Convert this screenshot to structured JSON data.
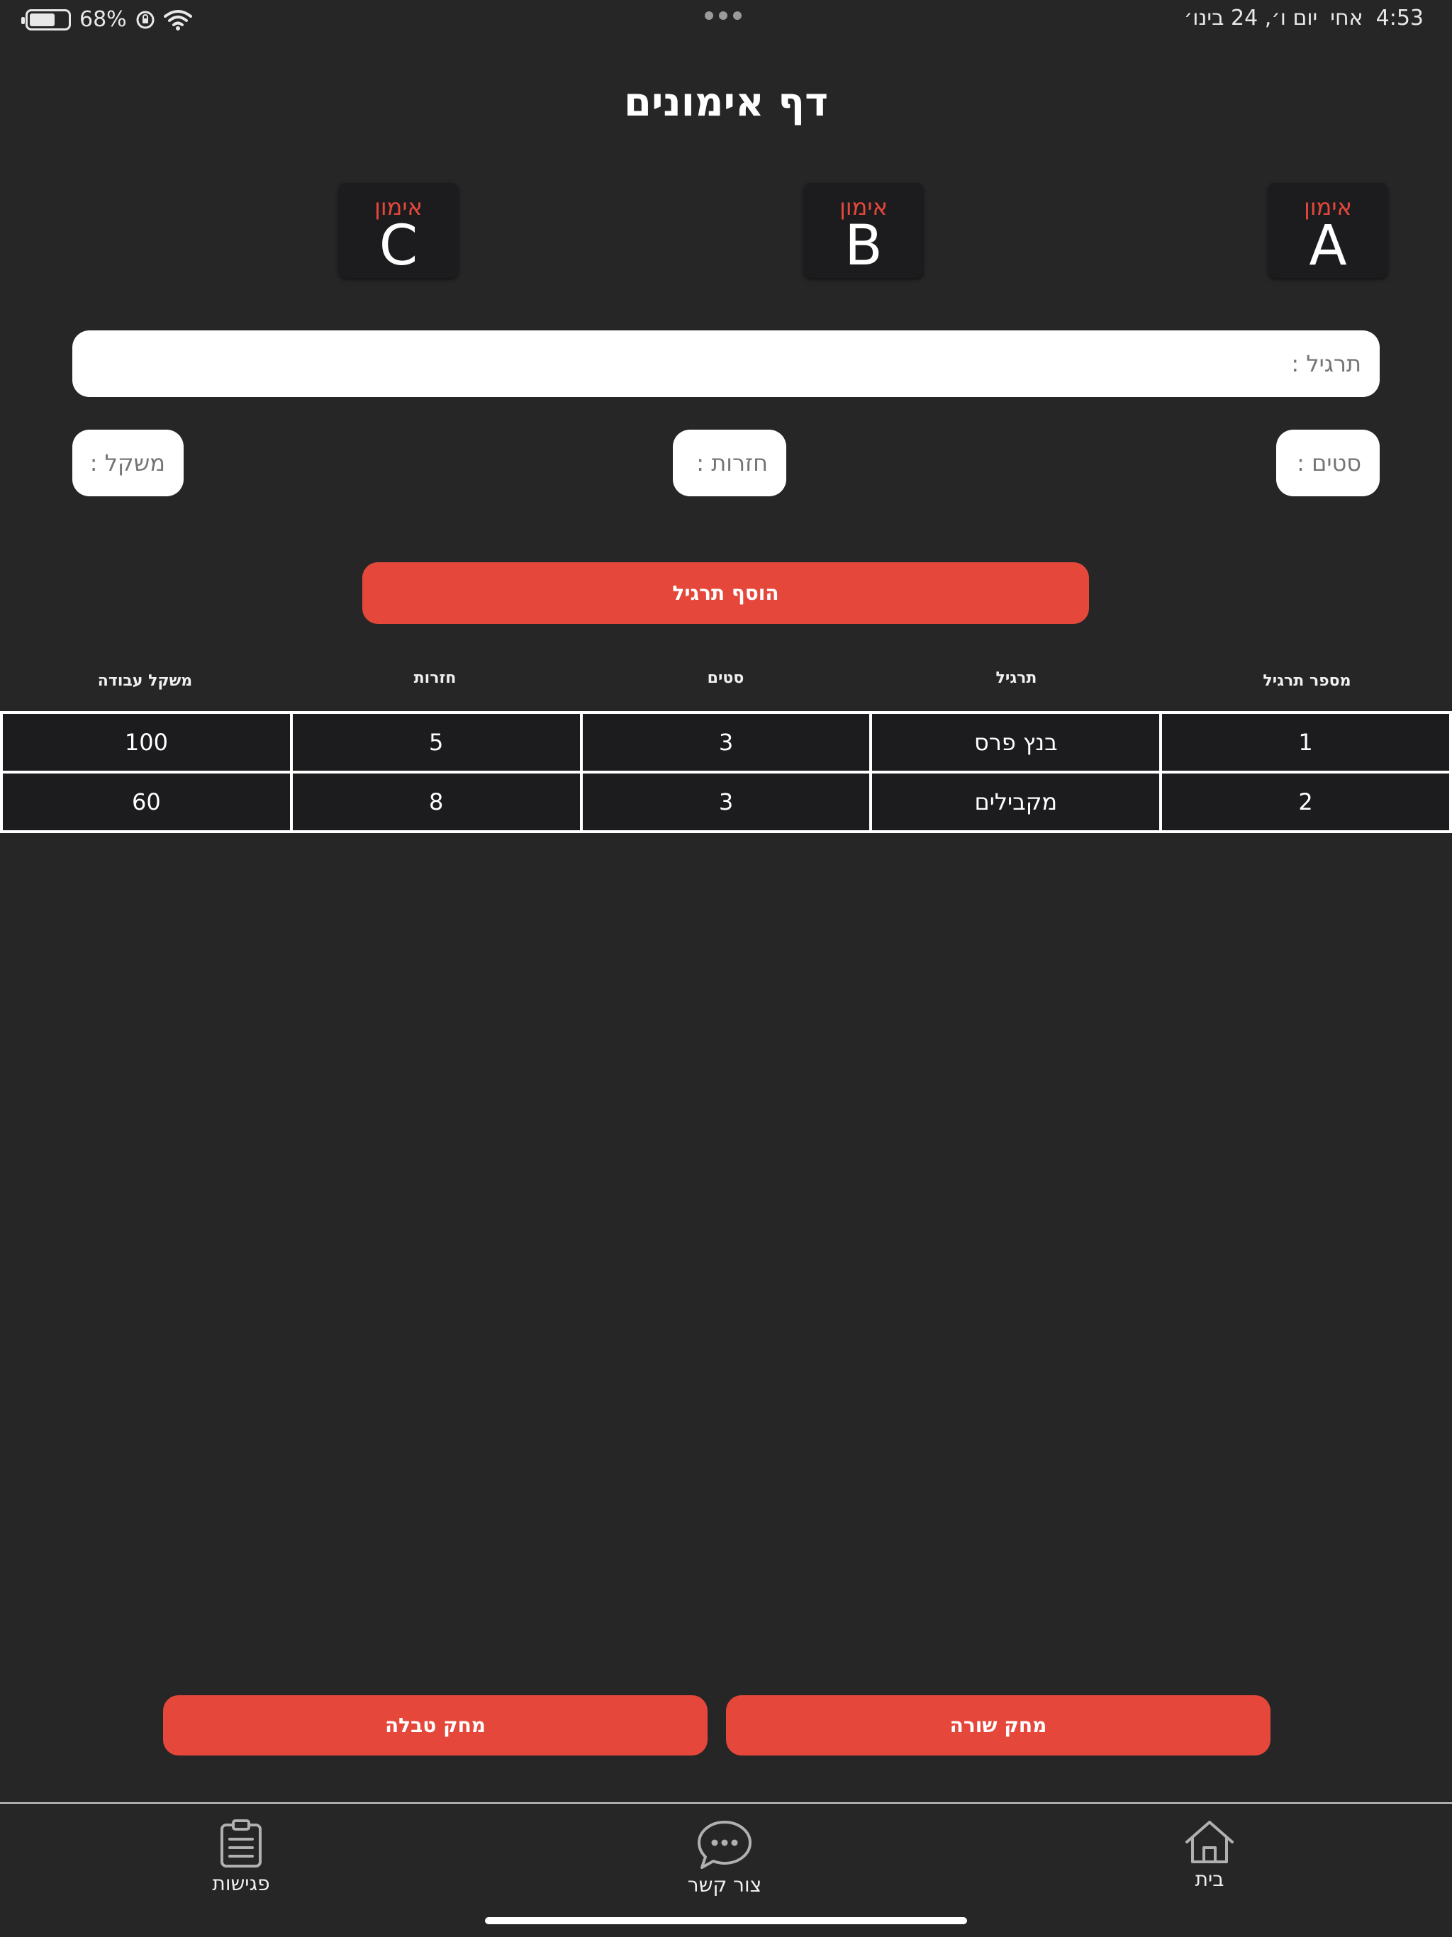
{
  "status_bar": {
    "time": "4:53",
    "day": "אחי",
    "date": "יום ו׳, 24 בינו׳",
    "battery": "68%",
    "battery_level": 0.68
  },
  "page": {
    "title": "דף אימונים"
  },
  "workouts": [
    {
      "label": "אימון",
      "letter": "A"
    },
    {
      "label": "אימון",
      "letter": "B"
    },
    {
      "label": "אימון",
      "letter": "C"
    }
  ],
  "form": {
    "exercise_placeholder": "תרגיל :",
    "sets_placeholder": "סטים :",
    "reps_placeholder": "חזרות :",
    "weight_placeholder": "משקל :",
    "add_button": "הוסף תרגיל"
  },
  "table": {
    "headers": {
      "number": "מספר תרגיל",
      "exercise": "תרגיל",
      "sets": "סטים",
      "reps": "חזרות",
      "weight": "משקל עבודה"
    },
    "rows": [
      {
        "number": "1",
        "exercise": "בנץ פרס",
        "sets": "3",
        "reps": "5",
        "weight": "100"
      },
      {
        "number": "2",
        "exercise": "מקבילים",
        "sets": "3",
        "reps": "8",
        "weight": "60"
      }
    ]
  },
  "actions": {
    "delete_row": "מחק שורה",
    "delete_table": "מחק טבלה"
  },
  "tabs": {
    "home": "בית",
    "contact": "צור קשר",
    "meetings": "פגישות"
  }
}
